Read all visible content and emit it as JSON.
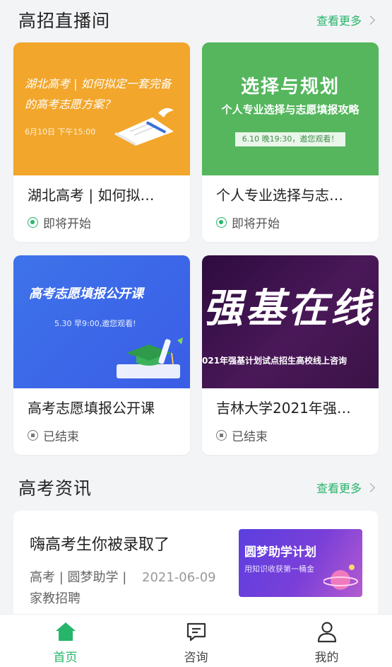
{
  "live": {
    "title": "高招直播间",
    "more": "查看更多",
    "cards": [
      {
        "title": "湖北高考 | 如何拟…",
        "status": "即将开始",
        "thumb": {
          "line1": "湖北高考 | 如何拟定一套完备",
          "line2": "的高考志愿方案？",
          "date": "6月10日 下午15:00"
        }
      },
      {
        "title": "个人专业选择与志…",
        "status": "即将开始",
        "thumb": {
          "title": "选择与规划",
          "sub": "个人专业选择与志愿填报攻略",
          "pill": "6.10 晚19:30，邀您观看！"
        }
      },
      {
        "title": "高考志愿填报公开课",
        "status": "已结束",
        "thumb": {
          "title": "高考志愿填报公开课",
          "date": "5.30 早9:00,邀您观看!"
        }
      },
      {
        "title": "吉林大学2021年强…",
        "status": "已结束",
        "thumb": {
          "big": "强基在线",
          "sub": "021年强基计划试点招生高校线上咨询"
        }
      }
    ]
  },
  "news": {
    "title": "高考资讯",
    "more": "查看更多",
    "items": [
      {
        "title": "嗨高考生你被录取了",
        "tags": "高考 | 圆梦助学 | 家教招聘",
        "date": "2021-06-09",
        "thumb": {
          "title": "圆梦助学计划",
          "sub": "用知识收获第一桶金"
        }
      }
    ]
  },
  "tabbar": {
    "items": [
      {
        "label": "首页",
        "icon": "home-icon",
        "active": true
      },
      {
        "label": "咨询",
        "icon": "chat-icon",
        "active": false
      },
      {
        "label": "我的",
        "icon": "user-icon",
        "active": false
      }
    ],
    "accent": "#27b56a"
  }
}
